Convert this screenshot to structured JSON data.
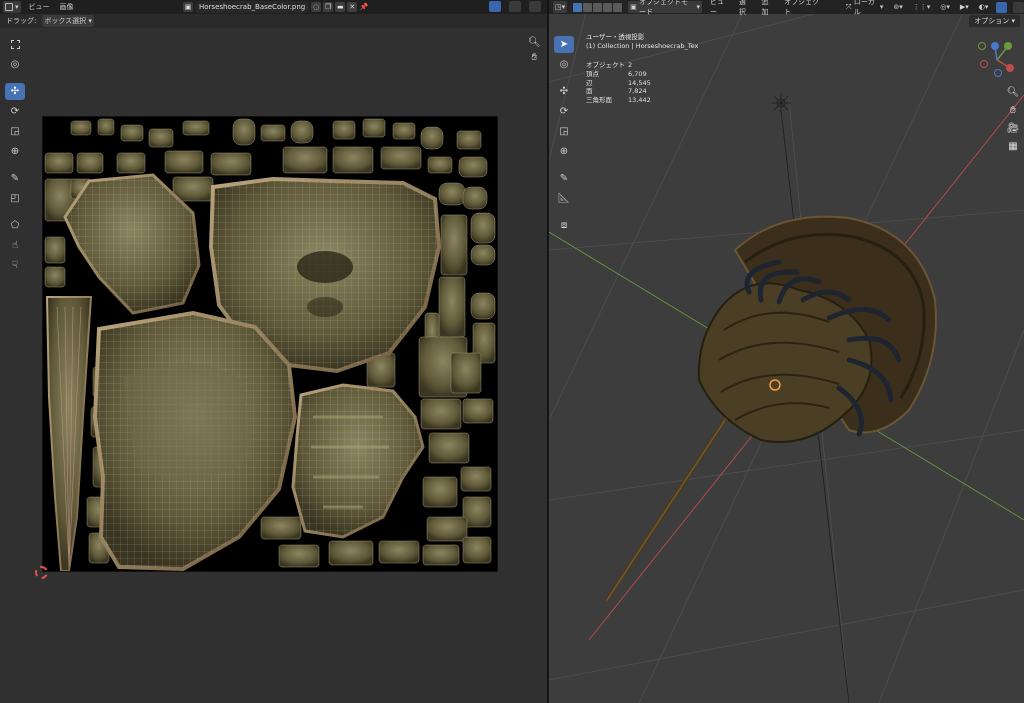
{
  "uv_editor": {
    "menu": {
      "view": "ビュー",
      "image": "画像"
    },
    "image_name": "Horseshoecrab_BaseColor.png",
    "drag_label": "ドラッグ:",
    "drag_mode": "ボックス選択",
    "tools": [
      "select-box-icon",
      "cursor-icon",
      "move-icon",
      "rotate-icon",
      "scale-icon",
      "transform-icon",
      "annotate-icon",
      "grab-icon",
      "relax-icon",
      "pinch-icon",
      "sample-icon"
    ]
  },
  "viewport": {
    "mode": "オブジェクトモード",
    "menu": {
      "view": "ビュー",
      "select": "選択",
      "add": "追加",
      "object": "オブジェクト"
    },
    "orientation": "ローカル",
    "options": "オプション",
    "view_name": "ユーザー・透視投影",
    "collection": "(1) Collection | Horseshoecrab_Tex",
    "stats": [
      {
        "label": "オブジェクト",
        "value": "2"
      },
      {
        "label": "頂点",
        "value": "6,709"
      },
      {
        "label": "辺",
        "value": "14,545"
      },
      {
        "label": "面",
        "value": "7,824"
      },
      {
        "label": "三角形面",
        "value": "13,442"
      }
    ],
    "colors": {
      "x_axis": "#c04c4c",
      "y_axis": "#6a9a3a",
      "z_axis": "#4a7ad0",
      "grid": "#4a4a4a"
    }
  }
}
